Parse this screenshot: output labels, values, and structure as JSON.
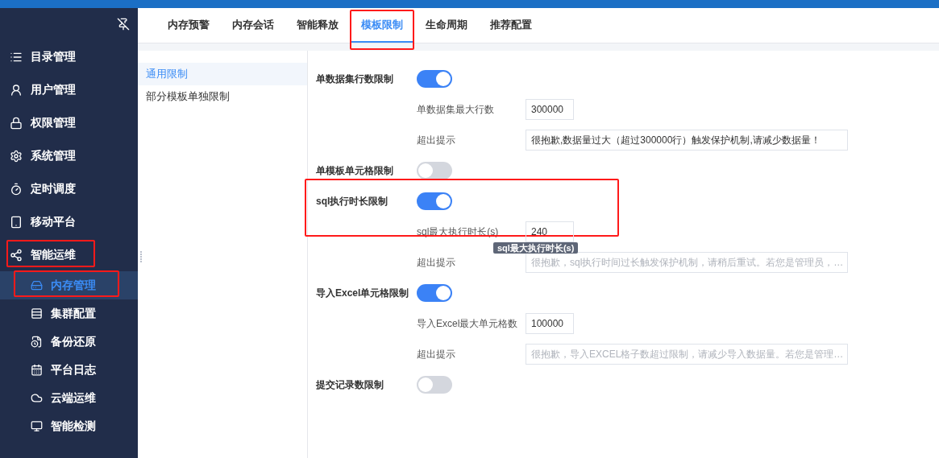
{
  "sidebar": {
    "items": [
      {
        "label": "目录管理",
        "selected": false,
        "annotated": false
      },
      {
        "label": "用户管理",
        "selected": false,
        "annotated": false
      },
      {
        "label": "权限管理",
        "selected": false,
        "annotated": false
      },
      {
        "label": "系统管理",
        "selected": false,
        "annotated": false
      },
      {
        "label": "定时调度",
        "selected": false,
        "annotated": false
      },
      {
        "label": "移动平台",
        "selected": false,
        "annotated": false
      },
      {
        "label": "智能运维",
        "selected": false,
        "annotated": true,
        "expanded": true,
        "children": [
          {
            "label": "内存管理",
            "selected": true,
            "annotated": true
          },
          {
            "label": "集群配置",
            "selected": false,
            "annotated": false
          },
          {
            "label": "备份还原",
            "selected": false,
            "annotated": false
          },
          {
            "label": "平台日志",
            "selected": false,
            "annotated": false
          },
          {
            "label": "云端运维",
            "selected": false,
            "annotated": false
          },
          {
            "label": "智能检测",
            "selected": false,
            "annotated": false
          }
        ]
      }
    ]
  },
  "tabs": [
    {
      "label": "内存预警",
      "selected": false,
      "annotated": false
    },
    {
      "label": "内存会话",
      "selected": false,
      "annotated": false
    },
    {
      "label": "智能释放",
      "selected": false,
      "annotated": false
    },
    {
      "label": "模板限制",
      "selected": true,
      "annotated": true
    },
    {
      "label": "生命周期",
      "selected": false,
      "annotated": false
    },
    {
      "label": "推荐配置",
      "selected": false,
      "annotated": false
    }
  ],
  "submenu": [
    {
      "label": "通用限制",
      "selected": true
    },
    {
      "label": "部分模板单独限制",
      "selected": false
    }
  ],
  "sections": [
    {
      "label": "单数据集行数限制",
      "on": true,
      "annotated": false,
      "fields": [
        {
          "label": "单数据集最大行数",
          "kind": "short",
          "value": "300000"
        },
        {
          "label": "超出提示",
          "kind": "long",
          "value": "很抱歉,数据量过大（超过300000行）触发保护机制,请减少数据量！"
        }
      ]
    },
    {
      "label": "单模板单元格限制",
      "on": false,
      "annotated": false
    },
    {
      "label": "sql执行时长限制",
      "on": true,
      "annotated": true,
      "fields": [
        {
          "label": "sql最大执行时长(s)",
          "kind": "short",
          "value": "240",
          "tooltip": "sql最大执行时长(s)"
        },
        {
          "label": "超出提示",
          "kind": "long",
          "placeholder": "很抱歉，sql执行时间过长触发保护机制，请稍后重试。若您是管理员，…"
        }
      ]
    },
    {
      "label": "导入Excel单元格限制",
      "on": true,
      "annotated": false,
      "fields": [
        {
          "label": "导入Excel最大单元格数",
          "kind": "short",
          "value": "100000"
        },
        {
          "label": "超出提示",
          "kind": "long",
          "placeholder": "很抱歉，导入EXCEL格子数超过限制，请减少导入数据量。若您是管理…"
        }
      ]
    },
    {
      "label": "提交记录数限制",
      "on": false,
      "annotated": false
    }
  ]
}
